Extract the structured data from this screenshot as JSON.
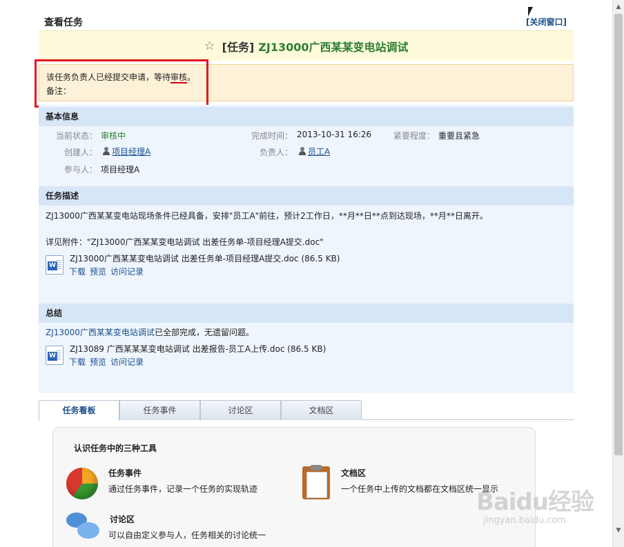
{
  "header": {
    "page_title": "查看任务",
    "close_link": "[关闭窗口]",
    "task_prefix": "[任务]",
    "task_title": "ZJ13000广西某某变电站调试"
  },
  "notice": {
    "line1_before": "该任务负责人已经提交申请，等待",
    "line1_highlight": "审核",
    "line1_after": "。",
    "line2": "备注："
  },
  "basic": {
    "heading": "基本信息",
    "status_label": "当前状态：",
    "status_value": "审核中",
    "finish_label": "完成时间：",
    "finish_value": "2013-10-31 16:26",
    "urgency_label": "紧要程度：",
    "urgency_value": "重要且紧急",
    "creator_label": "创建人：",
    "creator_value": "项目经理A",
    "owner_label": "负责人：",
    "owner_value": "员工A",
    "participant_label": "参与人：",
    "participant_value": "项目经理A"
  },
  "description": {
    "heading": "任务描述",
    "text": "ZJ13000广西某某变电站现场条件已经具备，安排\"员工A\"前往，预计2工作日，**月**日**点到达现场，**月**日离开。",
    "attachment_note": "详见附件：\"ZJ13000广西某某变电站调试 出差任务单-项目经理A提交.doc\"",
    "file_name": "ZJ13000广西某某变电站调试 出差任务单-项目经理A提交.doc (86.5 KB)",
    "actions": [
      "下载",
      "预览",
      "访问记录"
    ]
  },
  "summary": {
    "heading": "总结",
    "link_text": "ZJ13000广西某某变电站调试",
    "text_after": "已全部完成，无遗留问题。",
    "file_name": "ZJ13089 广西某某某变电站调试 出差报告-员工A上传.doc (86.5 KB)",
    "actions": [
      "下载",
      "预览",
      "访问记录"
    ]
  },
  "tabs": [
    "任务看板",
    "任务事件",
    "讨论区",
    "文档区"
  ],
  "tools": {
    "title": "认识任务中的三种工具",
    "events_title": "任务事件",
    "events_desc": "通过任务事件，记录一个任务的实现轨迹",
    "docs_title": "文档区",
    "docs_desc": "一个任务中上传的文档都在文档区统一显示",
    "discuss_title": "讨论区",
    "discuss_desc": "可以自由定义参与人，任务相关的讨论统一"
  },
  "watermark": {
    "main": "Baidu经验",
    "sub": "jingyan.baidu.com"
  }
}
